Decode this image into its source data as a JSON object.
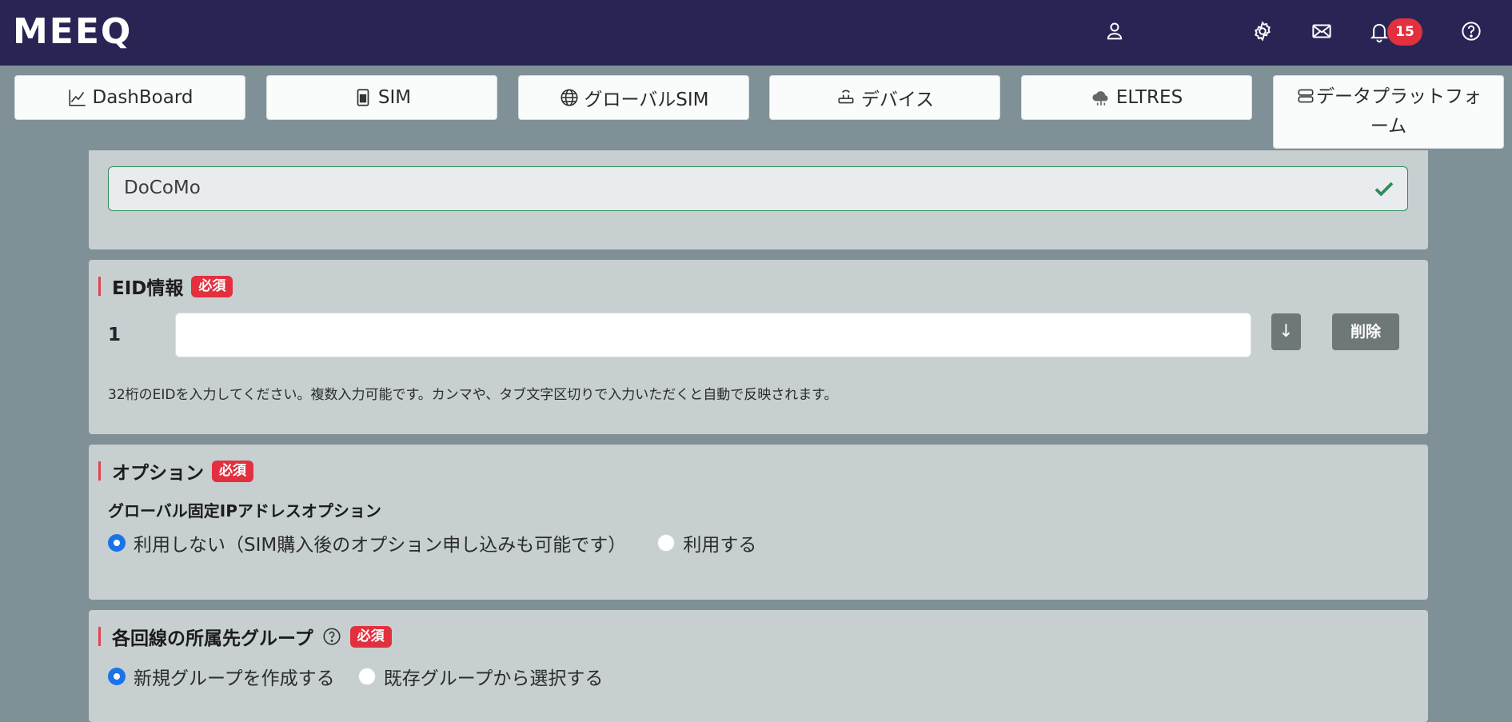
{
  "header": {
    "logo": "MEEQ",
    "notifications_count": "15",
    "icons": [
      "user-icon",
      "gear-icon",
      "mail-icon",
      "bell-icon",
      "help-icon"
    ]
  },
  "nav": {
    "dashboard": "DashBoard",
    "sim": "SIM",
    "global_sim": "グローバルSIM",
    "device": "デバイス",
    "eltres": "ELTRES",
    "data_platform": "データプラットフォーム"
  },
  "carrier": {
    "value": "DoCoMo",
    "valid_color": "#2e8b57"
  },
  "eid": {
    "title": "EID情報",
    "required": "必須",
    "row_number": "1",
    "value": "",
    "download_label": "↓",
    "delete_label": "削除",
    "help": "32桁のEIDを入力してください。複数入力可能です。カンマや、タブ文字区切りで入力いただくと自動で反映されます。"
  },
  "option": {
    "title": "オプション",
    "required": "必須",
    "subtitle": "グローバル固定IPアドレスオプション",
    "choices": [
      "利用しない（SIM購入後のオプション申し込みも可能です）",
      "利用する"
    ],
    "selected": 0
  },
  "group": {
    "title": "各回線の所属先グループ",
    "required": "必須",
    "choices": [
      "新規グループを作成する",
      "既存グループから選択する"
    ],
    "selected": 0
  },
  "colors": {
    "header_bg": "#282555",
    "accent_red": "#e3303e",
    "radio_blue": "#1a73e8",
    "card_bg": "#c7cfd1"
  }
}
